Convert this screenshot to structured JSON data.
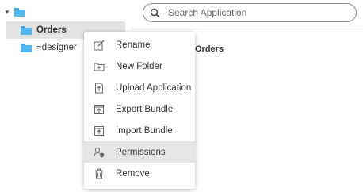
{
  "tree": {
    "root_caret": "▾",
    "items": [
      {
        "label": "Orders",
        "selected": true
      },
      {
        "label": "~designer",
        "selected": false
      }
    ],
    "folder_color": "#4fb7f2"
  },
  "search": {
    "placeholder": "Search Application",
    "value": ""
  },
  "content": {
    "title": "Orders"
  },
  "context_menu": {
    "items": [
      {
        "label": "Rename",
        "icon": "rename-icon"
      },
      {
        "label": "New Folder",
        "icon": "new-folder-icon"
      },
      {
        "label": "Upload Application",
        "icon": "upload-icon"
      },
      {
        "label": "Export Bundle",
        "icon": "export-icon"
      },
      {
        "label": "Import Bundle",
        "icon": "import-icon"
      },
      {
        "label": "Permissions",
        "icon": "permissions-icon",
        "highlighted": true
      },
      {
        "label": "Remove",
        "icon": "trash-icon"
      }
    ]
  }
}
